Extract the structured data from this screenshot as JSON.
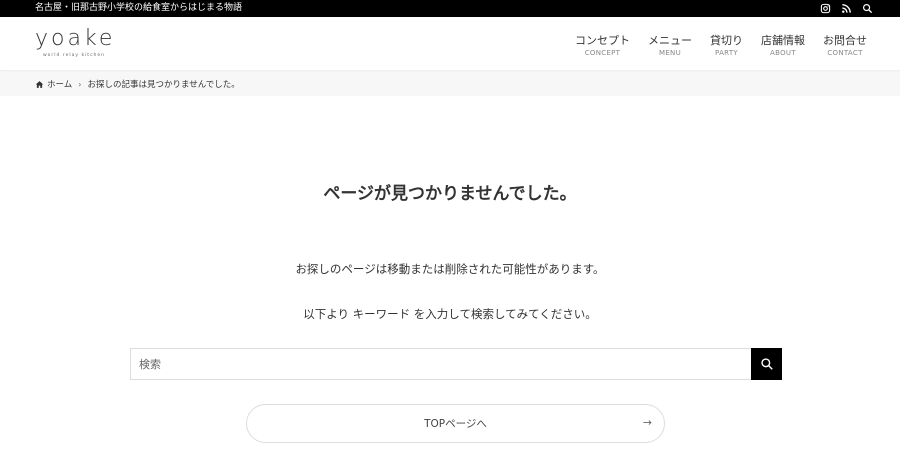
{
  "topbar": {
    "tagline": "名古屋・旧那古野小学校の給食室からはじまる物語",
    "icons": [
      "instagram-icon",
      "rss-icon",
      "search-icon"
    ]
  },
  "logo": {
    "text": "yoake",
    "sub": "world relay kitchen"
  },
  "nav": [
    {
      "jp": "コンセプト",
      "en": "CONCEPT"
    },
    {
      "jp": "メニュー",
      "en": "MENU"
    },
    {
      "jp": "貸切り",
      "en": "PARTY"
    },
    {
      "jp": "店舗情報",
      "en": "ABOUT"
    },
    {
      "jp": "お問合せ",
      "en": "CONTACT"
    }
  ],
  "breadcrumb": {
    "home": "ホーム",
    "current": "お探しの記事は見つかりませんでした。"
  },
  "main": {
    "title": "ページが見つかりませんでした。",
    "message1": "お探しのページは移動または削除された可能性があります。",
    "message2": "以下より キーワード を入力して検索してみてください。",
    "search_placeholder": "検索",
    "top_button_label": "TOPページへ",
    "top_button_arrow": "→"
  },
  "colors": {
    "topbar_bg": "#000000",
    "breadcrumb_bg": "#f7f7f7",
    "search_button_bg": "#000000"
  }
}
